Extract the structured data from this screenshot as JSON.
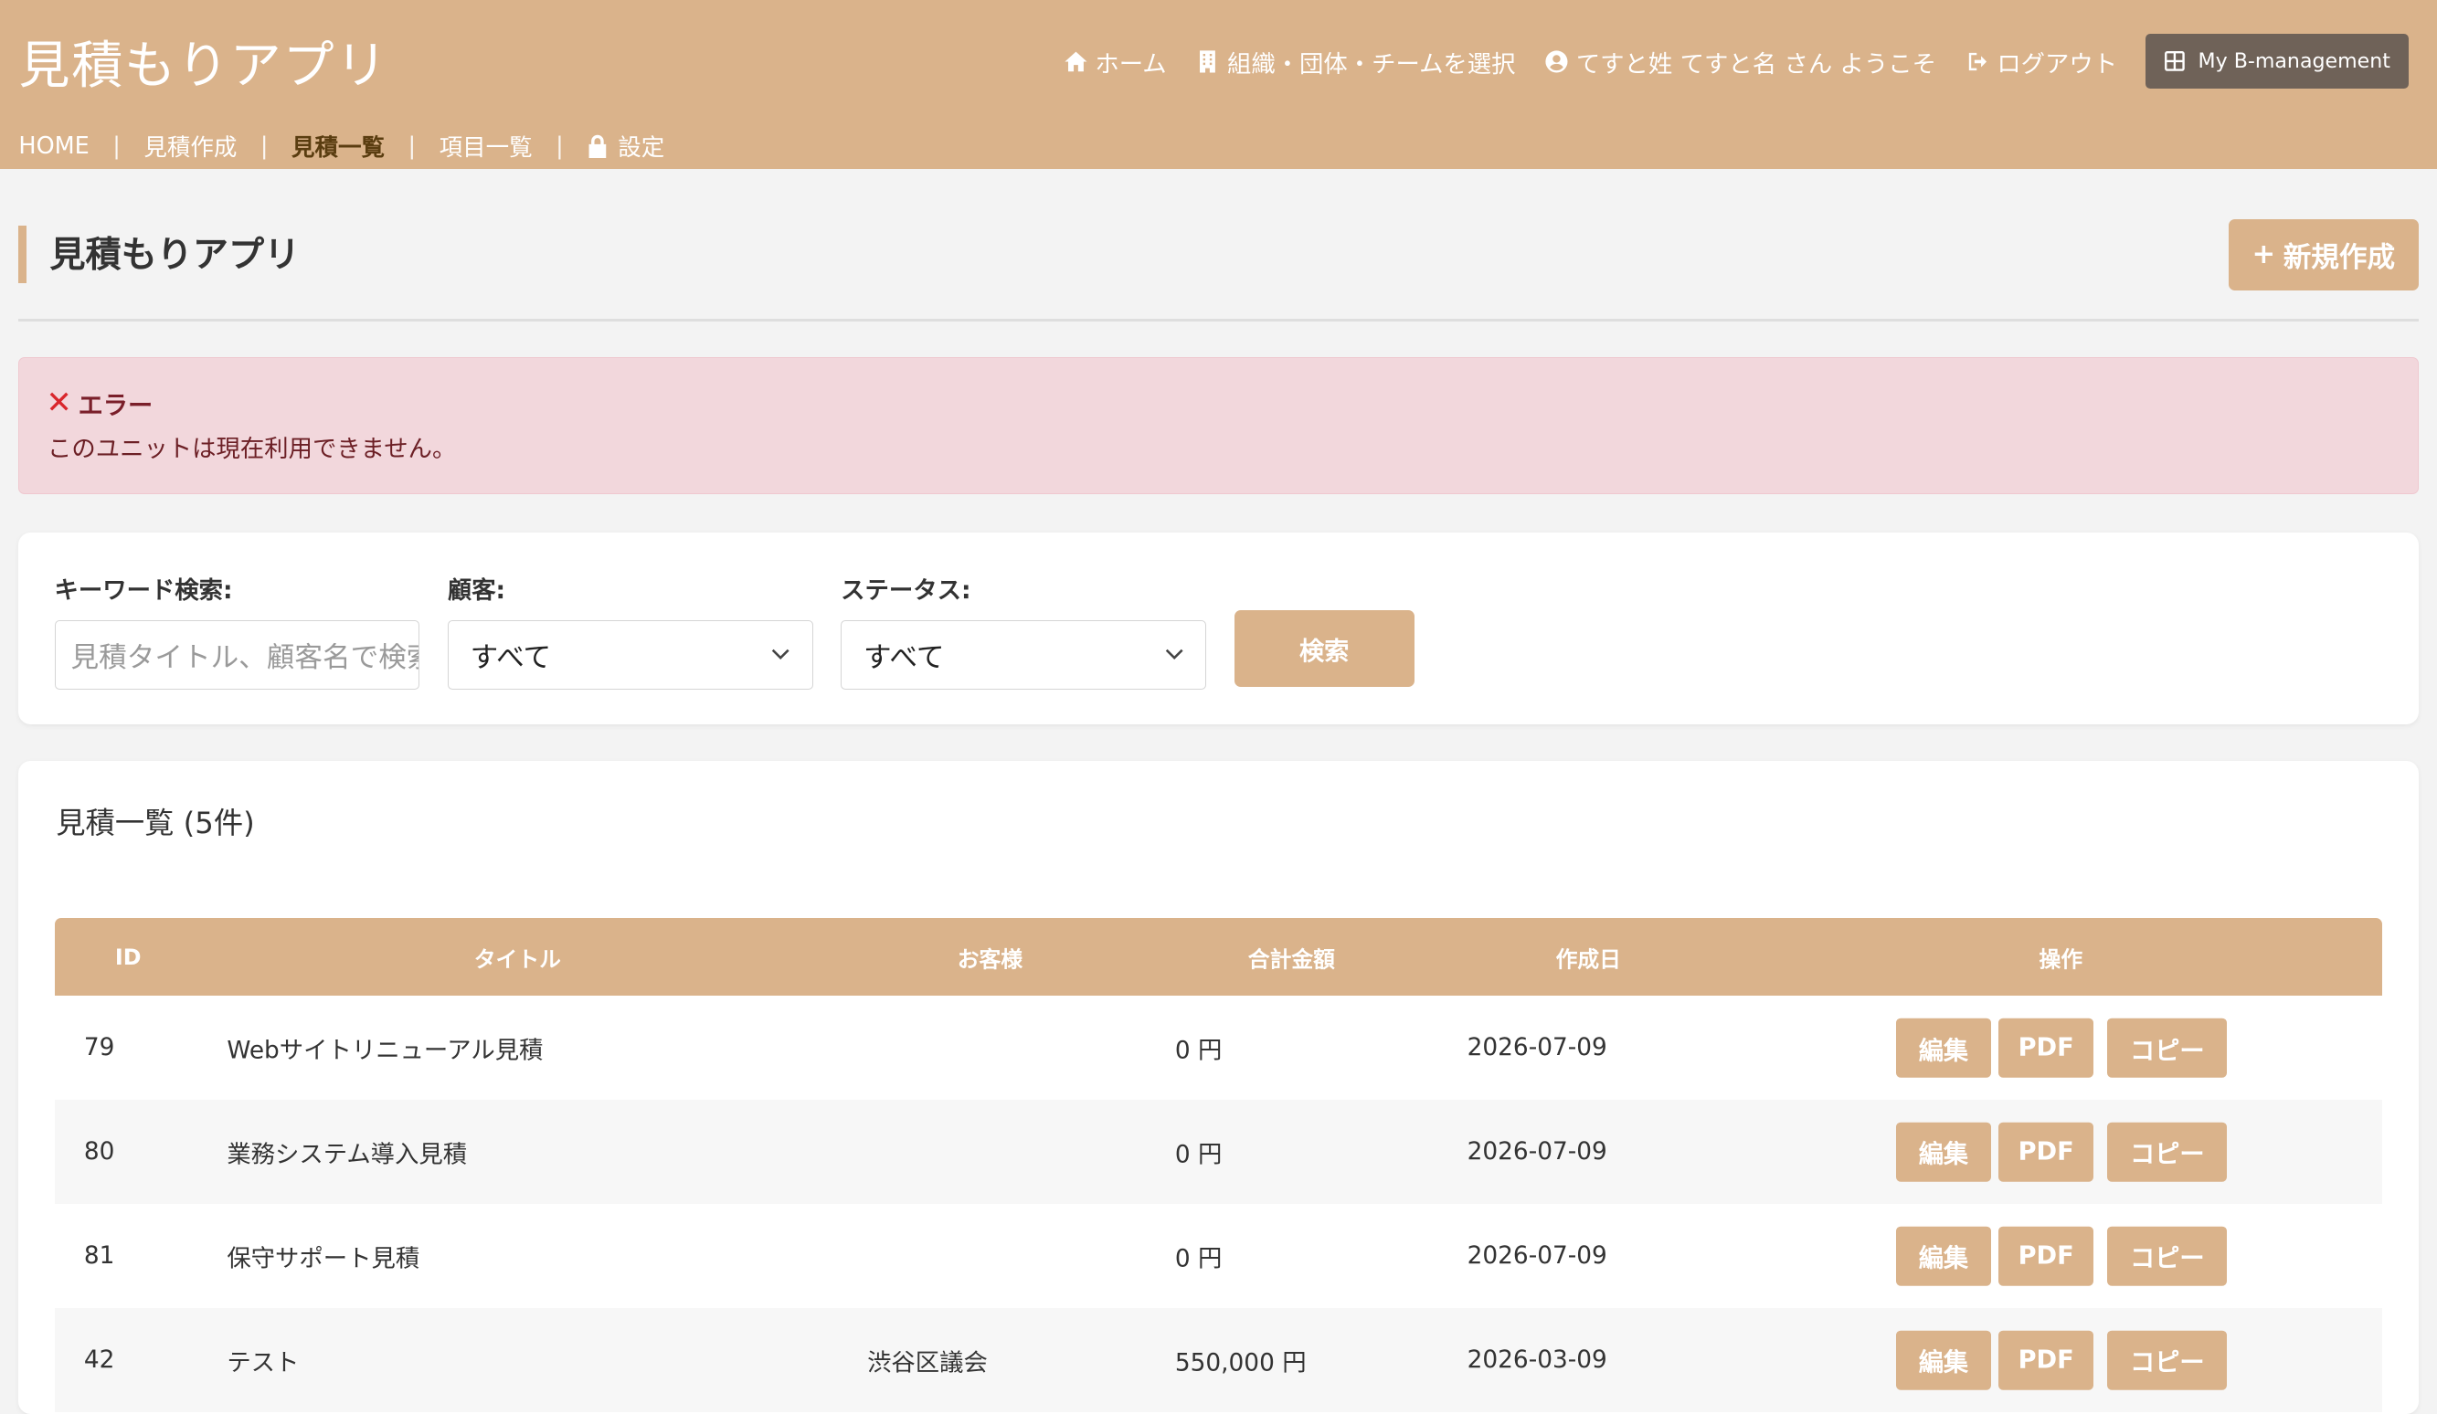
{
  "app": {
    "title": "見積もりアプリ"
  },
  "header_nav": {
    "home": "ホーム",
    "org_select": "組織・団体・チームを選択",
    "welcome": "てすと姓 てすと名 さん ようこそ",
    "logout": "ログアウト",
    "my_bm": "My B-management"
  },
  "subnav": {
    "items": [
      "HOME",
      "見積作成",
      "見積一覧",
      "項目一覧",
      "設定"
    ],
    "separator": "|",
    "active": "見積一覧"
  },
  "page": {
    "title": "見積もりアプリ",
    "new_button": "新規作成",
    "new_icon": "+"
  },
  "alert": {
    "heading": "エラー",
    "message": "このユニットは現在利用できません。",
    "icon": "✕"
  },
  "search": {
    "keyword_label": "キーワード検索:",
    "keyword_placeholder": "見積タイトル、顧客名で検索",
    "customer_label": "顧客:",
    "customer_value": "すべて",
    "status_label": "ステータス:",
    "status_value": "すべて",
    "button": "検索"
  },
  "list": {
    "title": "見積一覧 (5件)",
    "columns": [
      "ID",
      "タイトル",
      "お客様",
      "合計金額",
      "作成日",
      "操作"
    ],
    "actions": [
      "編集",
      "PDF",
      "コピー"
    ],
    "rows": [
      {
        "id": "79",
        "title": "Webサイトリニューアル見積",
        "customer": "",
        "total": "0 円",
        "date": "2026-07-09"
      },
      {
        "id": "80",
        "title": "業務システム導入見積",
        "customer": "",
        "total": "0 円",
        "date": "2026-07-09"
      },
      {
        "id": "81",
        "title": "保守サポート見積",
        "customer": "",
        "total": "0 円",
        "date": "2026-07-09"
      },
      {
        "id": "42",
        "title": "テスト",
        "customer": "渋谷区議会",
        "total": "550,000 円",
        "date": "2026-03-09"
      }
    ]
  },
  "colors": {
    "brand": "#dab38b",
    "alert_bg": "#f2d7dc",
    "dark_button": "#6f6258"
  }
}
